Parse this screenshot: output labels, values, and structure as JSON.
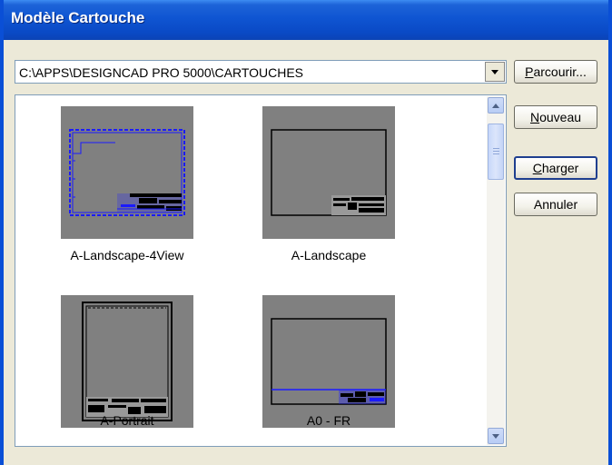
{
  "window": {
    "title": "Modèle Cartouche"
  },
  "path_combo": {
    "value": "C:\\APPS\\DESIGNCAD PRO 5000\\CARTOUCHES"
  },
  "buttons": {
    "browse": {
      "mnemonic": "P",
      "rest": "arcourir..."
    },
    "new": {
      "mnemonic": "N",
      "rest": "ouveau"
    },
    "load": {
      "mnemonic": "C",
      "rest": "harger"
    },
    "cancel": {
      "label": "Annuler"
    }
  },
  "templates": [
    {
      "name": "A-Landscape-4View"
    },
    {
      "name": "A-Landscape"
    },
    {
      "name": "A-Portrait"
    },
    {
      "name": "A0 - FR"
    }
  ],
  "colors": {
    "title_bar": "#0a4ac6",
    "thumb_bg": "#808080",
    "accent_blue": "#1a1aff"
  },
  "icons": [
    "dropdown-arrow-icon",
    "scroll-up-icon",
    "scroll-down-icon"
  ]
}
